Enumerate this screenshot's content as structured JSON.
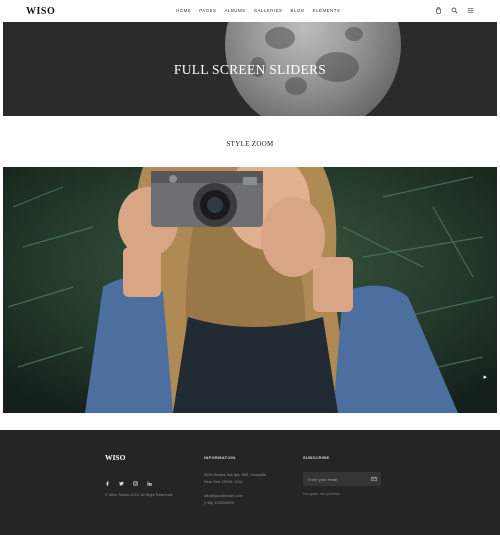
{
  "header": {
    "logo": "WISO",
    "nav": [
      "HOME",
      "PAGES",
      "ALBUMS",
      "GALLERIES",
      "BLOG",
      "ELEMENTS"
    ],
    "icons": [
      "cart-icon",
      "search-icon",
      "menu-icon"
    ]
  },
  "hero": {
    "title": "FULL SCREEN SLIDERS"
  },
  "section": {
    "title": "STYLE ZOOM"
  },
  "slider": {
    "next_arrow": "▸"
  },
  "footer": {
    "logo": "WISO",
    "socials": [
      "facebook-icon",
      "twitter-icon",
      "instagram-icon",
      "linkedin-icon"
    ],
    "copyright": "© Wiso Studio 2016. All Right Reserved.",
    "information": {
      "title": "INFORMATION",
      "address_line1": "2005 Stokes Isle Apt. 896, Venaville,",
      "address_line2": "New York 10010, USA",
      "email": "info@yourdomain.com",
      "phone": "(+68) 120034509"
    },
    "subscribe": {
      "title": "SUBSCRIBE",
      "placeholder": "Enter your email",
      "note": "No spam, we promise"
    }
  },
  "colors": {
    "hero_bg": "#2b2b2b",
    "footer_bg": "#252525",
    "input_bg": "#353535"
  }
}
